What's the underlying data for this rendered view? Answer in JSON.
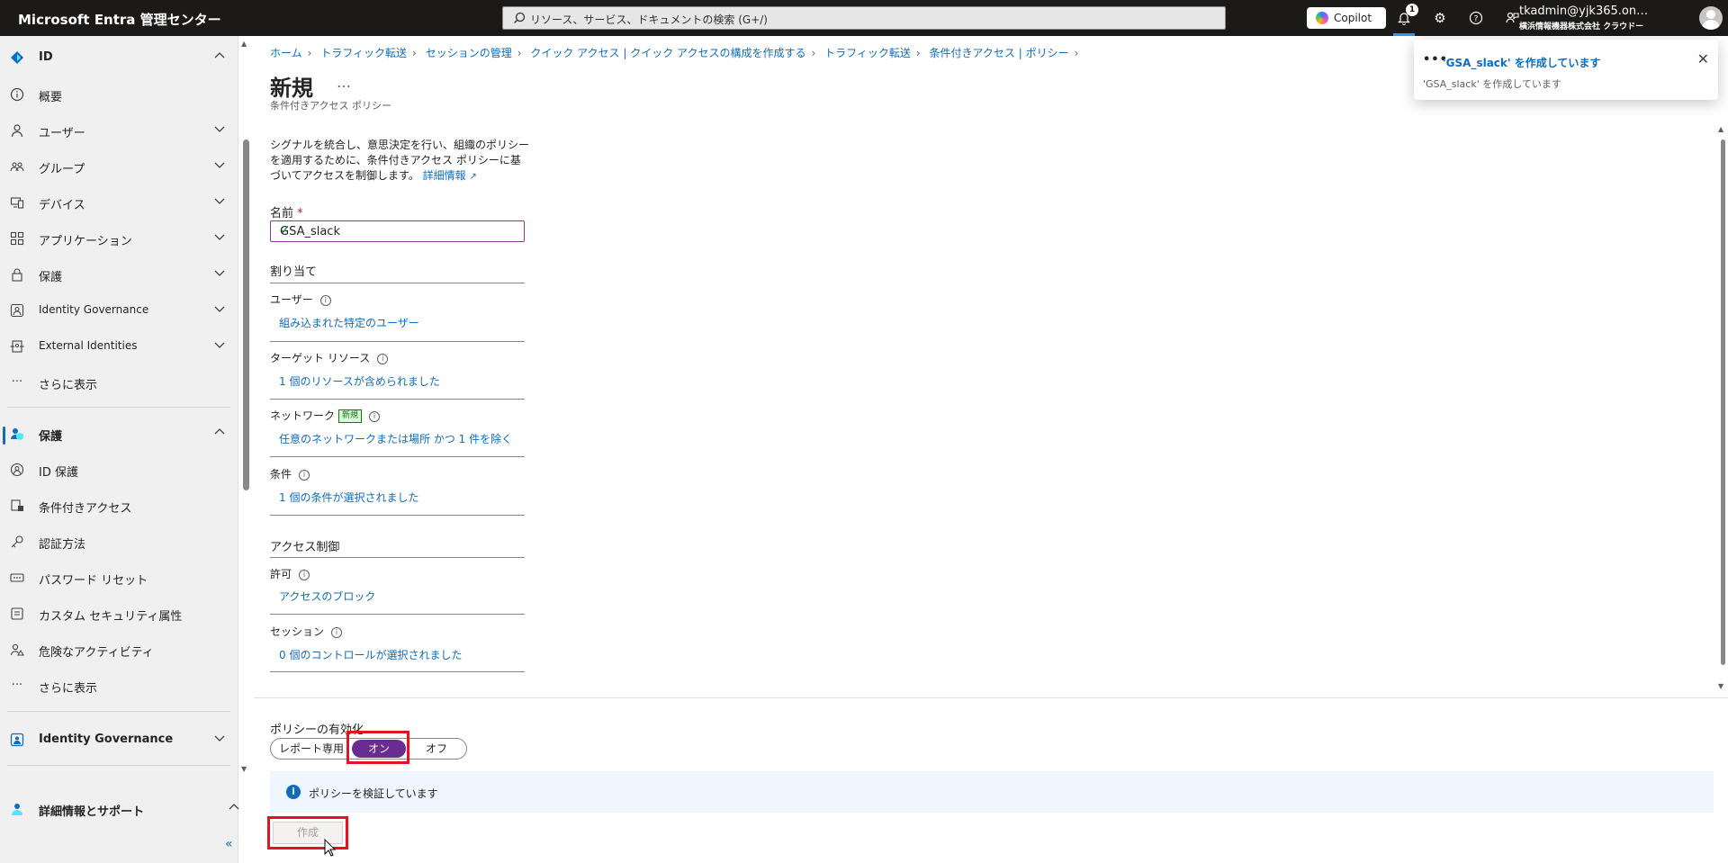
{
  "topbar": {
    "app_title": "Microsoft Entra 管理センター",
    "search_placeholder": "リソース、サービス、ドキュメントの検索 (G+/)",
    "copilot_label": "Copilot",
    "notification_count": "1",
    "user_name": "tkadmin@yjk365.on…",
    "user_org": "横浜情報機器株式会社 クラウドー"
  },
  "sidebar": {
    "items": [
      {
        "label": "ID",
        "icon": "entra-diamond-icon"
      },
      {
        "label": "概要",
        "icon": "info-icon"
      },
      {
        "label": "ユーザー",
        "icon": "person-icon"
      },
      {
        "label": "グループ",
        "icon": "people-icon"
      },
      {
        "label": "デバイス",
        "icon": "device-icon"
      },
      {
        "label": "アプリケーション",
        "icon": "apps-icon"
      },
      {
        "label": "保護",
        "icon": "lock-icon"
      },
      {
        "label": "Identity Governance",
        "icon": "governance-icon"
      },
      {
        "label": "External Identities",
        "icon": "external-identities-icon"
      },
      {
        "label": "さらに表示",
        "icon": "more-icon"
      },
      {
        "label": "保護",
        "icon": "protection-icon"
      },
      {
        "label": "ID 保護",
        "icon": "id-protection-icon"
      },
      {
        "label": "条件付きアクセス",
        "icon": "conditional-access-icon"
      },
      {
        "label": "認証方法",
        "icon": "key-icon"
      },
      {
        "label": "パスワード リセット",
        "icon": "password-icon"
      },
      {
        "label": "カスタム セキュリティ属性",
        "icon": "attribute-icon"
      },
      {
        "label": "危険なアクティビティ",
        "icon": "risky-activity-icon"
      },
      {
        "label": "さらに表示",
        "icon": "more-icon"
      },
      {
        "label": "Identity Governance",
        "icon": "governance-icon"
      },
      {
        "label": "詳細情報とサポート",
        "icon": "support-person-icon"
      }
    ],
    "collapse_glyph": "«"
  },
  "breadcrumb": [
    "ホーム",
    "トラフィック転送",
    "セッションの管理",
    "クイック アクセス | クイック アクセスの構成を作成する",
    "トラフィック転送",
    "条件付きアクセス | ポリシー"
  ],
  "page": {
    "title": "新規",
    "more": "…",
    "subtitle": "条件付きアクセス ポリシー",
    "description": "シグナルを統合し、意思決定を行い、組織のポリシーを適用するために、条件付きアクセス ポリシーに基づいてアクセスを制御します。",
    "learn_more": "詳細情報",
    "name_label": "名前",
    "required_mark": "*",
    "name_value": "GSA_slack",
    "assignments_title": "割り当て",
    "users_label": "ユーザー",
    "users_value": "組み込まれた特定のユーザー",
    "target_label": "ターゲット リソース",
    "target_value": "1 個のリソースが含められました",
    "network_label": "ネットワーク",
    "network_badge": "新規",
    "network_value": "任意のネットワークまたは場所 かつ 1 件を除く",
    "conditions_label": "条件",
    "conditions_value": "1 個の条件が選択されました",
    "access_title": "アクセス制御",
    "grant_label": "許可",
    "grant_value": "アクセスのブロック",
    "session_label": "セッション",
    "session_value": "0 個のコントロールが選択されました"
  },
  "bottom": {
    "enable_label": "ポリシーの有効化",
    "toggle": {
      "report_only": "レポート専用",
      "on": "オン",
      "off": "オフ",
      "selected": "オン"
    },
    "message": "ポリシーを検証しています",
    "create_label": "作成"
  },
  "toast": {
    "title": "'GSA_slack' を作成しています",
    "body": "'GSA_slack' を作成しています"
  },
  "colors": {
    "accent": "#0f6cbd",
    "toggle_on": "#6b2c91",
    "highlight": "#e81123",
    "topbar": "#1b1a19"
  }
}
